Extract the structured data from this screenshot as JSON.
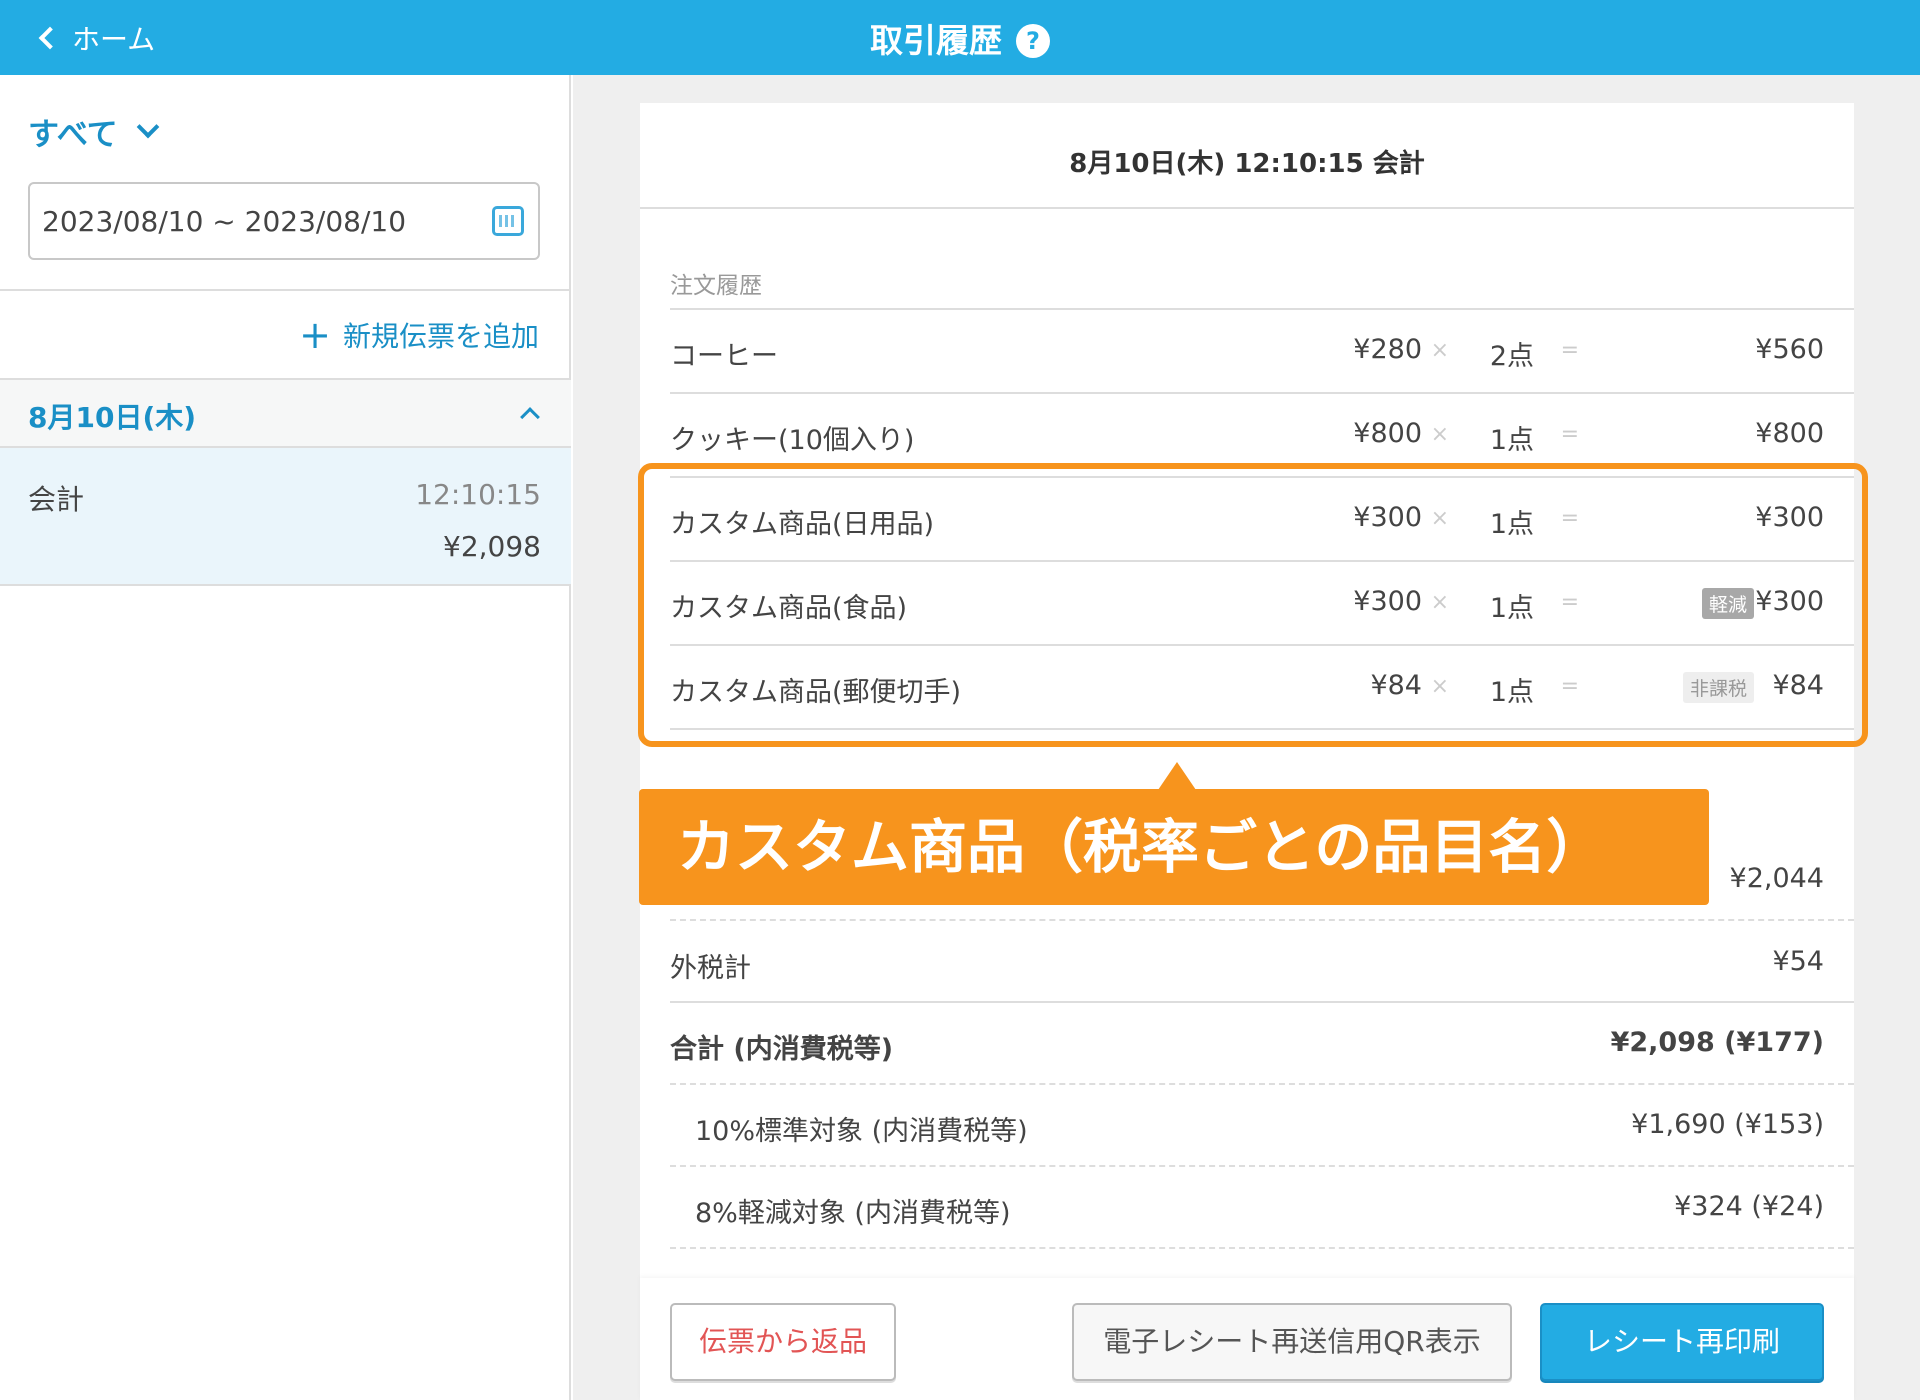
{
  "header": {
    "back_label": "ホーム",
    "title": "取引履歴",
    "help_glyph": "?"
  },
  "sidebar": {
    "filter_label": "すべて",
    "date_range": "2023/08/10 ~ 2023/08/10",
    "add_slip_label": "新規伝票を追加",
    "date_group": "8月10日(木)",
    "transactions": [
      {
        "name": "会計",
        "time": "12:10:15",
        "amount": "¥2,098"
      }
    ]
  },
  "detail": {
    "heading": "8月10日(木) 12:10:15 会計",
    "section_label": "注文履歴",
    "items": [
      {
        "name": "コーヒー",
        "unit_price": "¥280",
        "times": "×",
        "qty": "2点",
        "eq": "=",
        "total": "¥560",
        "tag": ""
      },
      {
        "name": "クッキー(10個入り)",
        "unit_price": "¥800",
        "times": "×",
        "qty": "1点",
        "eq": "=",
        "total": "¥800",
        "tag": ""
      },
      {
        "name": "カスタム商品(日用品)",
        "unit_price": "¥300",
        "times": "×",
        "qty": "1点",
        "eq": "=",
        "total": "¥300",
        "tag": ""
      },
      {
        "name": "カスタム商品(食品)",
        "unit_price": "¥300",
        "times": "×",
        "qty": "1点",
        "eq": "=",
        "total": "¥300",
        "tag": "軽減"
      },
      {
        "name": "カスタム商品(郵便切手)",
        "unit_price": "¥84",
        "times": "×",
        "qty": "1点",
        "eq": "=",
        "total": "¥84",
        "tag": "非課税"
      }
    ],
    "subtotal_value": "¥2,044",
    "outer_tax_label": "外税計",
    "outer_tax_value": "¥54",
    "total_label": "合計 (内消費税等)",
    "total_value": "¥2,098 (¥177)",
    "standard_label": "10%標準対象 (内消費税等)",
    "standard_value": "¥1,690 (¥153)",
    "reduced_label": "8%軽減対象 (内消費税等)",
    "reduced_value": "¥324 (¥24)"
  },
  "buttons": {
    "return_label": "伝票から返品",
    "qr_label": "電子レシート再送信用QR表示",
    "reprint_label": "レシート再印刷"
  },
  "annotation": {
    "callout_text": "カスタム商品（税率ごとの品目名）",
    "color": "#f7941d"
  },
  "colors": {
    "header_bg": "#23ace3",
    "accent": "#1a8fc6",
    "return_text": "#e25555"
  }
}
